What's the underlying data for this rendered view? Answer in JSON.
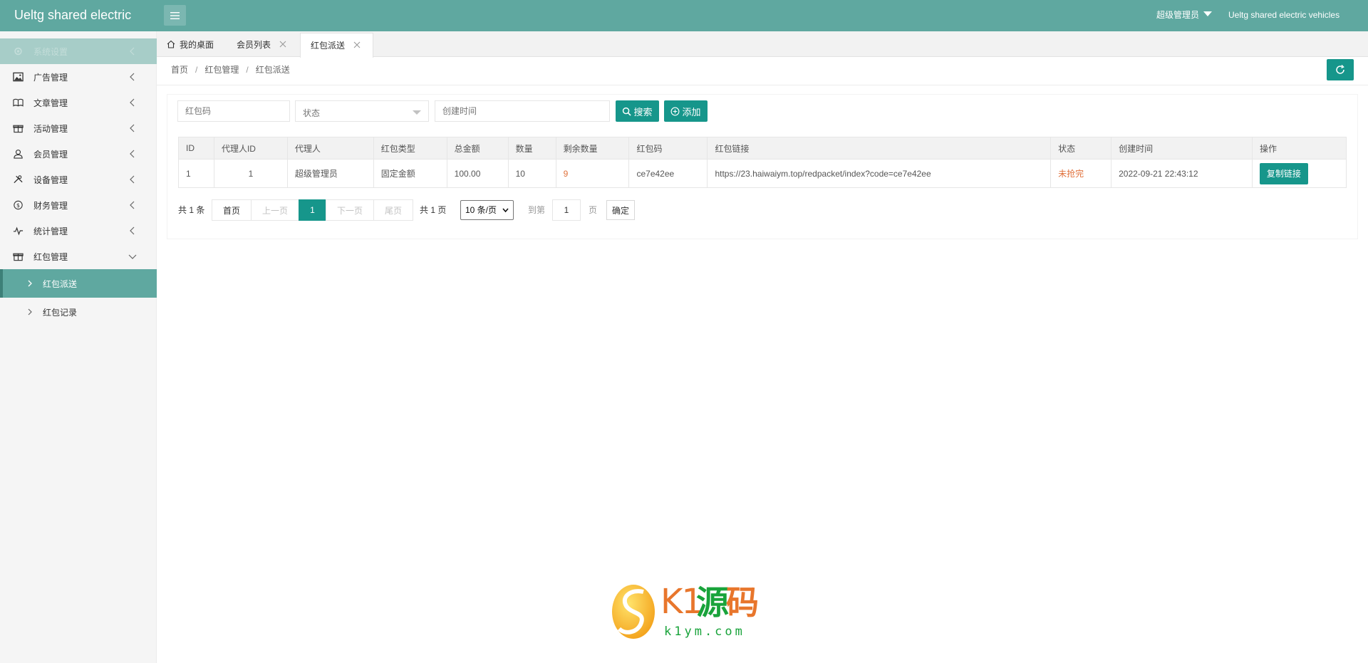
{
  "header": {
    "logo": "Ueltg shared electric",
    "user": "超级管理员",
    "site": "Ueltg shared electric vehicles"
  },
  "sidebar": {
    "items": [
      {
        "label": "系统设置",
        "icon": "gear-icon"
      },
      {
        "label": "广告管理",
        "icon": "image-icon"
      },
      {
        "label": "文章管理",
        "icon": "book-icon"
      },
      {
        "label": "活动管理",
        "icon": "gift-icon"
      },
      {
        "label": "会员管理",
        "icon": "user-icon"
      },
      {
        "label": "设备管理",
        "icon": "tools-icon"
      },
      {
        "label": "财务管理",
        "icon": "dollar-icon"
      },
      {
        "label": "统计管理",
        "icon": "pulse-icon"
      },
      {
        "label": "红包管理",
        "icon": "gift-icon"
      }
    ],
    "sub_items": [
      {
        "label": "红包派送"
      },
      {
        "label": "红包记录"
      }
    ]
  },
  "tabs": [
    {
      "label": "我的桌面"
    },
    {
      "label": "会员列表"
    },
    {
      "label": "红包派送"
    }
  ],
  "breadcrumb": [
    "首页",
    "红包管理",
    "红包派送"
  ],
  "breadcrumb_sep": "/",
  "filters": {
    "code_placeholder": "红包码",
    "status_placeholder": "状态",
    "time_placeholder": "创建时间",
    "search_label": "搜索",
    "add_label": "添加"
  },
  "table": {
    "headers": [
      "ID",
      "代理人ID",
      "代理人",
      "红包类型",
      "总金额",
      "数量",
      "剩余数量",
      "红包码",
      "红包链接",
      "状态",
      "创建时间",
      "操作"
    ],
    "rows": [
      {
        "id": "1",
        "agent_id": "1",
        "agent": "超级管理员",
        "type": "固定金额",
        "total": "100.00",
        "count": "10",
        "remaining": "9",
        "code": "ce7e42ee",
        "link": "https://23.haiwaiym.top/redpacket/index?code=ce7e42ee",
        "status": "未抢完",
        "created": "2022-09-21 22:43:12",
        "action": "复制链接"
      }
    ]
  },
  "pager": {
    "total_text": "共 1 条",
    "first": "首页",
    "prev": "上一页",
    "current": "1",
    "next": "下一页",
    "last": "尾页",
    "pages_text": "共 1 页",
    "page_size": "10 条/页",
    "goto_prefix": "到第",
    "goto_value": "1",
    "goto_suffix": "页",
    "confirm": "确定"
  },
  "watermark": {
    "k1": "K1",
    "yuan": "源",
    "ma": "码",
    "domain": "k1ym.com"
  },
  "colors": {
    "header": "#5fa8a0",
    "primary": "#16968b",
    "warning": "#e0713b"
  }
}
